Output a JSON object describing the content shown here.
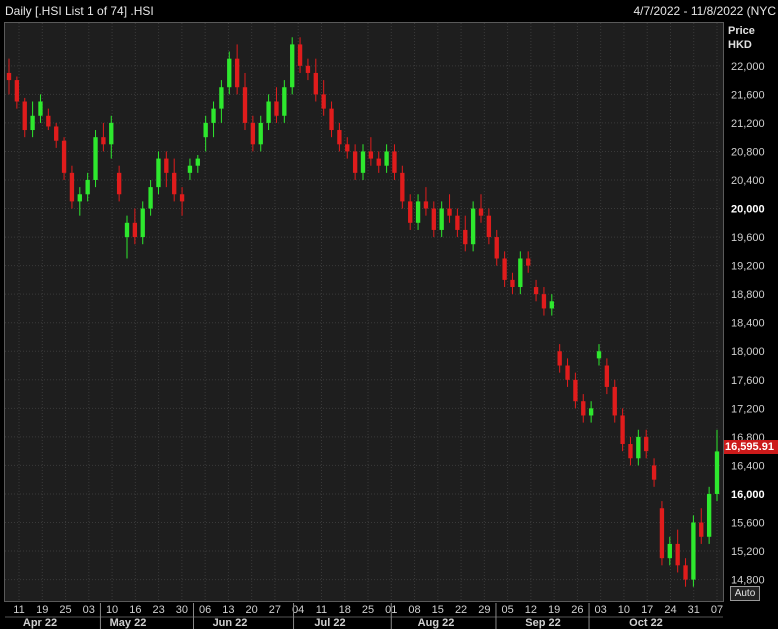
{
  "header": {
    "title": "Daily [.HSI List 1 of 74] .HSI",
    "date_range": "4/7/2022 - 11/8/2022 (NYC"
  },
  "y_axis": {
    "title_line1": "Price",
    "title_line2": "HKD"
  },
  "last_price_label": "16,595.91",
  "auto_label": "Auto",
  "colors": {
    "up": "#2ee82e",
    "down": "#e01c1c",
    "grid": "#2e3a2e",
    "background": "#1e1e1e",
    "last_price_bg": "#cc1a1a"
  },
  "chart_data": {
    "type": "candlestick",
    "title": "",
    "xlabel": "",
    "ylabel": "Price HKD",
    "ylim": [
      14500,
      22600
    ],
    "yticks": [
      14800,
      15200,
      15600,
      16000,
      16400,
      16800,
      17200,
      17600,
      18000,
      18400,
      18800,
      19200,
      19600,
      20000,
      20400,
      20800,
      21200,
      21600,
      22000
    ],
    "ytick_labels": [
      "14,800",
      "15,200",
      "15,600",
      "16,000",
      "16,400",
      "16,800",
      "17,200",
      "17,600",
      "18,000",
      "18,400",
      "18,800",
      "19,200",
      "19,600",
      "20,000",
      "20,400",
      "20,800",
      "21,200",
      "21,600",
      "22,000"
    ],
    "ytick_bold": [
      "16,000",
      "20,000"
    ],
    "x_week_labels": [
      "11",
      "19",
      "25",
      "03",
      "10",
      "16",
      "23",
      "30",
      "06",
      "13",
      "20",
      "27",
      "04",
      "11",
      "18",
      "25",
      "01",
      "08",
      "15",
      "22",
      "29",
      "05",
      "12",
      "19",
      "26",
      "03",
      "10",
      "17",
      "24",
      "31",
      "07"
    ],
    "x_month_labels": [
      "Apr 22",
      "May 22",
      "Jun 22",
      "Jul 22",
      "Aug 22",
      "Sep 22",
      "Oct 22"
    ],
    "grid": true,
    "candles": [
      [
        21900,
        22100,
        21600,
        21800
      ],
      [
        21800,
        21850,
        21400,
        21500
      ],
      [
        21500,
        21550,
        21000,
        21100
      ],
      [
        21100,
        21500,
        21000,
        21300
      ],
      [
        21300,
        21600,
        21200,
        21500
      ],
      [
        21300,
        21400,
        21100,
        21150
      ],
      [
        21150,
        21200,
        20850,
        20950
      ],
      [
        20950,
        21000,
        20400,
        20500
      ],
      [
        20500,
        20600,
        20000,
        20100
      ],
      [
        20100,
        20300,
        19900,
        20200
      ],
      [
        20200,
        20500,
        20100,
        20400
      ],
      [
        20400,
        21100,
        20300,
        21000
      ],
      [
        21000,
        21200,
        20800,
        20900
      ],
      [
        20900,
        21300,
        20700,
        21200
      ],
      [
        20500,
        20600,
        20100,
        20200
      ],
      [
        19600,
        19900,
        19300,
        19800
      ],
      [
        19800,
        20000,
        19500,
        19600
      ],
      [
        19600,
        20100,
        19500,
        20000
      ],
      [
        20000,
        20400,
        19900,
        20300
      ],
      [
        20300,
        20800,
        20200,
        20700
      ],
      [
        20700,
        20800,
        20300,
        20500
      ],
      [
        20500,
        20700,
        20100,
        20200
      ],
      [
        20200,
        20300,
        19900,
        20100
      ],
      [
        20500,
        20700,
        20400,
        20600
      ],
      [
        20600,
        20750,
        20500,
        20700
      ],
      [
        21000,
        21300,
        20800,
        21200
      ],
      [
        21200,
        21500,
        21000,
        21400
      ],
      [
        21400,
        21800,
        21200,
        21700
      ],
      [
        21700,
        22200,
        21600,
        22100
      ],
      [
        22100,
        22300,
        21600,
        21700
      ],
      [
        21700,
        21900,
        21100,
        21200
      ],
      [
        21200,
        21300,
        20800,
        20900
      ],
      [
        20900,
        21300,
        20800,
        21200
      ],
      [
        21200,
        21600,
        21100,
        21500
      ],
      [
        21500,
        21700,
        21200,
        21300
      ],
      [
        21300,
        21800,
        21200,
        21700
      ],
      [
        21700,
        22400,
        21600,
        22300
      ],
      [
        22300,
        22400,
        21900,
        22000
      ],
      [
        22000,
        22100,
        21800,
        21900
      ],
      [
        21900,
        22100,
        21500,
        21600
      ],
      [
        21600,
        21800,
        21300,
        21400
      ],
      [
        21400,
        21500,
        21000,
        21100
      ],
      [
        21100,
        21200,
        20800,
        20900
      ],
      [
        20900,
        21000,
        20700,
        20800
      ],
      [
        20800,
        20900,
        20400,
        20500
      ],
      [
        20500,
        20900,
        20400,
        20800
      ],
      [
        20800,
        21000,
        20600,
        20700
      ],
      [
        20700,
        20800,
        20500,
        20600
      ],
      [
        20600,
        20900,
        20500,
        20800
      ],
      [
        20800,
        20900,
        20400,
        20500
      ],
      [
        20500,
        20600,
        20000,
        20100
      ],
      [
        20100,
        20200,
        19700,
        19800
      ],
      [
        19800,
        20200,
        19700,
        20100
      ],
      [
        20100,
        20300,
        19900,
        20000
      ],
      [
        20000,
        20100,
        19600,
        19700
      ],
      [
        19700,
        20100,
        19600,
        20000
      ],
      [
        20000,
        20200,
        19800,
        19900
      ],
      [
        19900,
        20000,
        19600,
        19700
      ],
      [
        19700,
        19900,
        19400,
        19500
      ],
      [
        19500,
        20100,
        19400,
        20000
      ],
      [
        20000,
        20200,
        19800,
        19900
      ],
      [
        19900,
        20000,
        19500,
        19600
      ],
      [
        19600,
        19700,
        19200,
        19300
      ],
      [
        19300,
        19400,
        18900,
        19000
      ],
      [
        19000,
        19100,
        18800,
        18900
      ],
      [
        18900,
        19400,
        18800,
        19300
      ],
      [
        19300,
        19400,
        19100,
        19200
      ],
      [
        18900,
        19000,
        18700,
        18800
      ],
      [
        18800,
        18900,
        18500,
        18600
      ],
      [
        18600,
        18800,
        18500,
        18700
      ],
      [
        18000,
        18100,
        17700,
        17800
      ],
      [
        17800,
        17900,
        17500,
        17600
      ],
      [
        17600,
        17700,
        17200,
        17300
      ],
      [
        17300,
        17400,
        17000,
        17100
      ],
      [
        17100,
        17300,
        17000,
        17200
      ],
      [
        17900,
        18100,
        17800,
        18000
      ],
      [
        17800,
        17900,
        17400,
        17500
      ],
      [
        17500,
        17600,
        17000,
        17100
      ],
      [
        17100,
        17200,
        16600,
        16700
      ],
      [
        16700,
        16800,
        16400,
        16500
      ],
      [
        16500,
        16900,
        16400,
        16800
      ],
      [
        16800,
        16900,
        16500,
        16600
      ],
      [
        16400,
        16500,
        16100,
        16200
      ],
      [
        15800,
        15900,
        15000,
        15100
      ],
      [
        15100,
        15400,
        15000,
        15300
      ],
      [
        15300,
        15500,
        14900,
        15000
      ],
      [
        15000,
        15100,
        14700,
        14800
      ],
      [
        14800,
        15700,
        14700,
        15600
      ],
      [
        15600,
        15800,
        15300,
        15400
      ],
      [
        15400,
        16100,
        15300,
        16000
      ],
      [
        16000,
        16900,
        15900,
        16596
      ]
    ]
  }
}
